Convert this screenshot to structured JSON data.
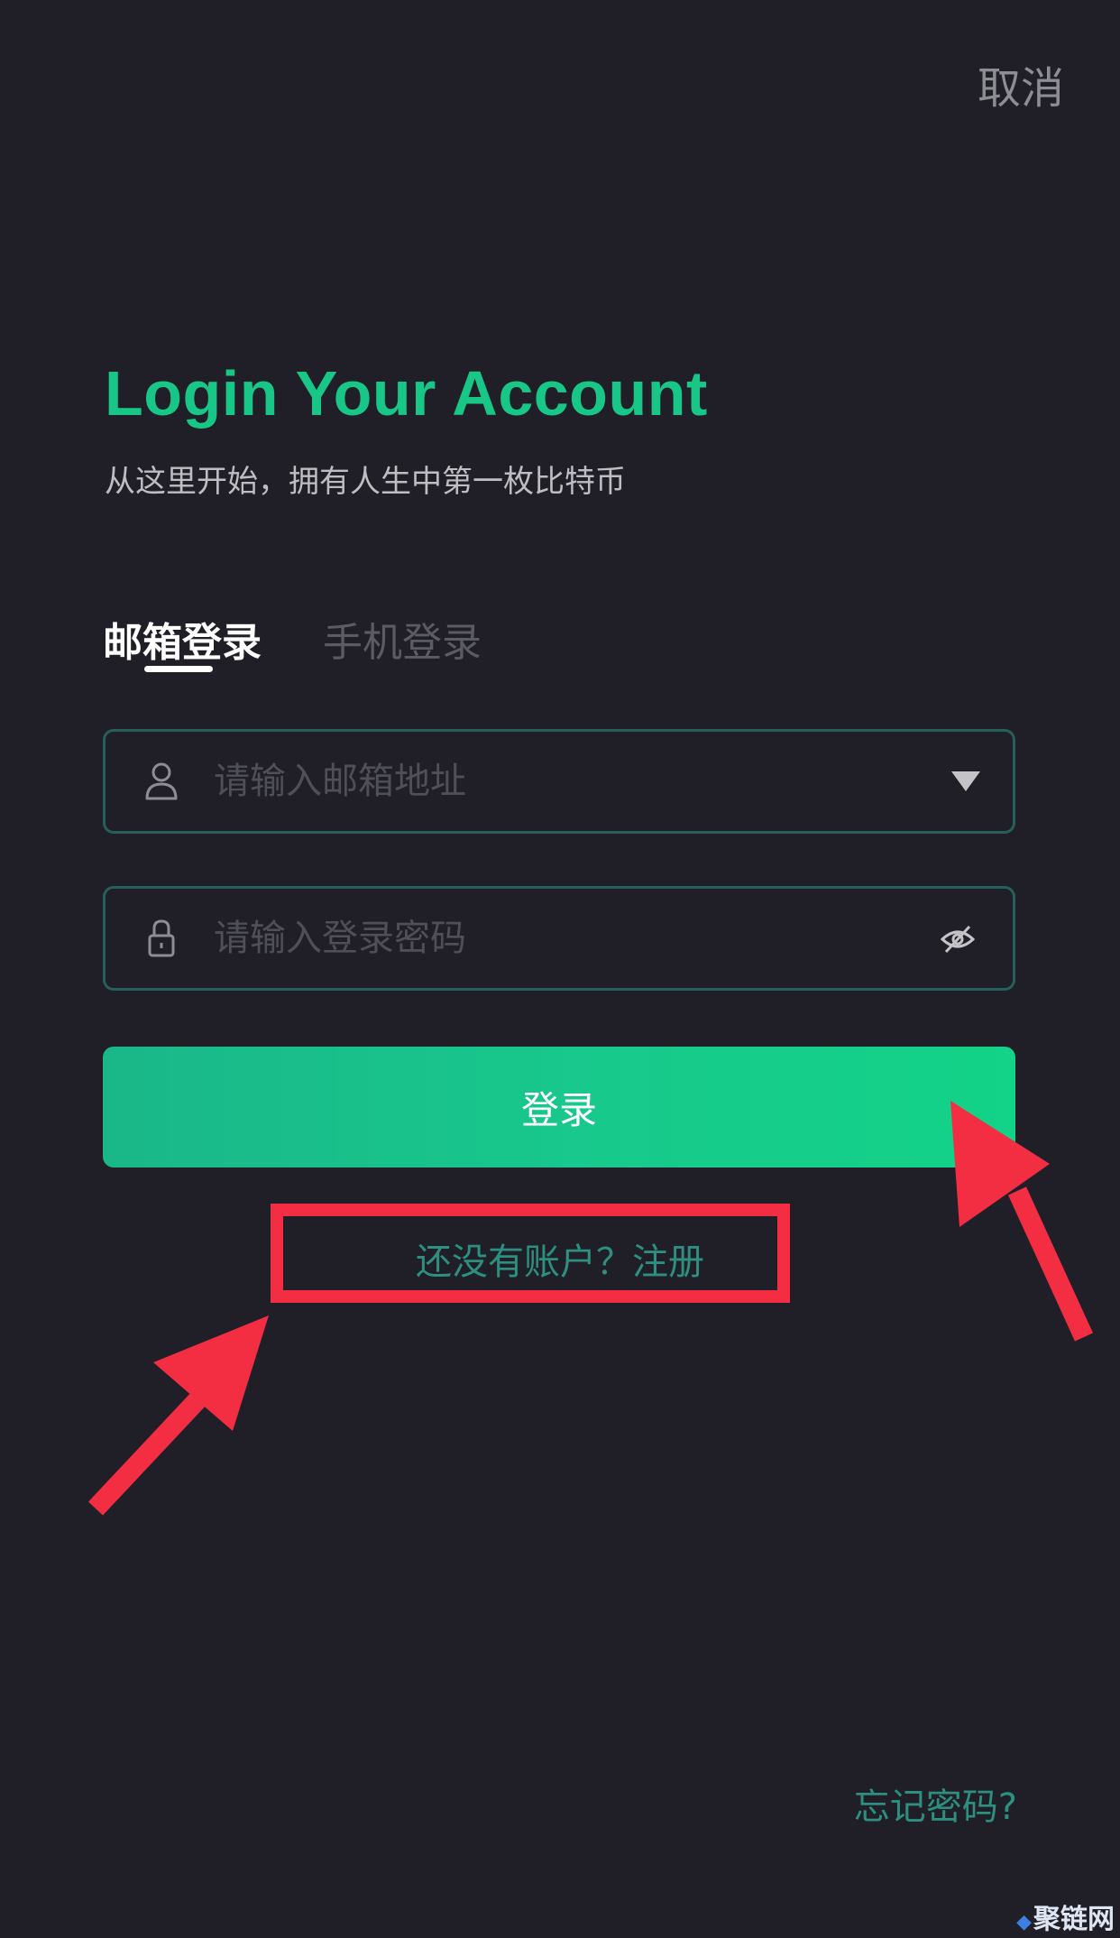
{
  "header": {
    "cancel_label": "取消"
  },
  "hero": {
    "title": "Login Your Account",
    "subtitle": "从这里开始，拥有人生中第一枚比特币"
  },
  "tabs": [
    {
      "label": "邮箱登录",
      "active": true
    },
    {
      "label": "手机登录",
      "active": false
    }
  ],
  "form": {
    "email": {
      "placeholder": "请输入邮箱地址",
      "value": "",
      "icon": "user-icon",
      "trailing_icon": "chevron-down-icon"
    },
    "password": {
      "placeholder": "请输入登录密码",
      "value": "",
      "icon": "lock-icon",
      "trailing_icon": "eye-off-icon"
    },
    "submit_label": "登录"
  },
  "links": {
    "register_label": "还没有账户？注册",
    "forgot_label": "忘记密码?"
  },
  "watermark": {
    "text": "聚链网"
  },
  "colors": {
    "background": "#201f28",
    "accent": "#18c788",
    "link": "#2d8f7f",
    "annotation": "#f32d42"
  }
}
